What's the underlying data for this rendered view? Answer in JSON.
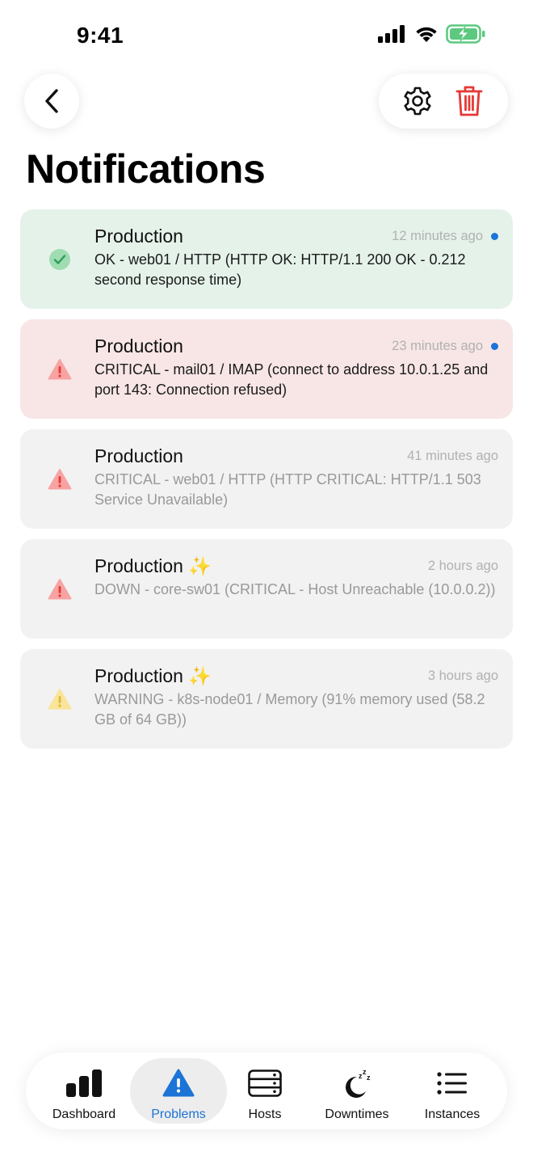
{
  "status_bar": {
    "time": "9:41"
  },
  "header": {
    "title": "Notifications"
  },
  "notifications": [
    {
      "state": "ok",
      "title": "Production",
      "time": "12 minutes ago",
      "message": "OK - web01 / HTTP (HTTP OK: HTTP/1.1 200 OK - 0.212 second response time)",
      "unread": true
    },
    {
      "state": "critical",
      "title": "Production",
      "time": "23 minutes ago",
      "message": "CRITICAL - mail01 / IMAP (connect to address 10.0.1.25 and port 143: Connection refused)",
      "unread": true
    },
    {
      "state": "critical",
      "title": "Production",
      "time": "41 minutes ago",
      "message": "CRITICAL - web01 / HTTP (HTTP CRITICAL: HTTP/1.1 503 Service Unavailable)",
      "unread": false
    },
    {
      "state": "critical",
      "title": "Production ✨",
      "time": "2 hours ago",
      "message": "DOWN - core-sw01 (CRITICAL - Host Unreachable (10.0.0.2))",
      "unread": false
    },
    {
      "state": "warning",
      "title": "Production ✨",
      "time": "3 hours ago",
      "message": "WARNING - k8s-node01 / Memory (91% memory used (58.2 GB of 64 GB))",
      "unread": false
    }
  ],
  "tabs": [
    {
      "label": "Dashboard",
      "icon": "bar-chart-icon"
    },
    {
      "label": "Problems",
      "icon": "warning-triangle-icon",
      "active": true
    },
    {
      "label": "Hosts",
      "icon": "server-icon"
    },
    {
      "label": "Downtimes",
      "icon": "moon-zzz-icon"
    },
    {
      "label": "Instances",
      "icon": "list-icon"
    }
  ],
  "colors": {
    "accent": "#1c74d6",
    "ok_card": "#e5f2ea",
    "critical_card": "#f8e6e6",
    "neutral_card": "#f2f2f2",
    "ok_icon": "#5cc97e",
    "critical_icon": "#f26a6a",
    "warning_icon": "#f5d35c",
    "delete_icon": "#e53935"
  }
}
